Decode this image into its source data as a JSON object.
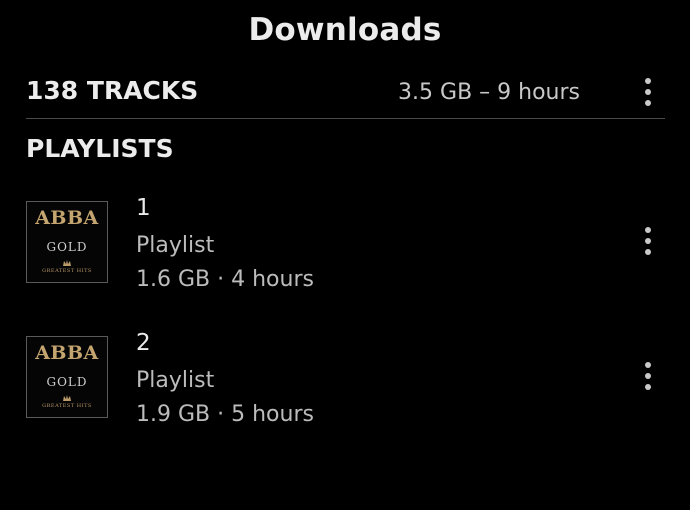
{
  "header": {
    "title": "Downloads"
  },
  "summary": {
    "tracks_label": "138 TRACKS",
    "size_duration": "3.5 GB – 9 hours",
    "more_icon": "more-vert-icon"
  },
  "section": {
    "heading": "PLAYLISTS"
  },
  "playlists": [
    {
      "name": "1",
      "type": "Playlist",
      "meta": "1.6 GB · 4 hours",
      "art": {
        "brand": "ABBA",
        "subtitle": "GOLD",
        "small_text": "GREATEST HITS"
      },
      "more_icon": "more-vert-icon"
    },
    {
      "name": "2",
      "type": "Playlist",
      "meta": "1.9 GB · 5 hours",
      "art": {
        "brand": "ABBA",
        "subtitle": "GOLD",
        "small_text": "GREATEST HITS"
      },
      "more_icon": "more-vert-icon"
    }
  ],
  "colors": {
    "background": "#000000",
    "primary_text": "#ececec",
    "secondary_text": "#bcbcbc",
    "album_gold": "#c4a46f",
    "divider": "#4a4a4a"
  }
}
